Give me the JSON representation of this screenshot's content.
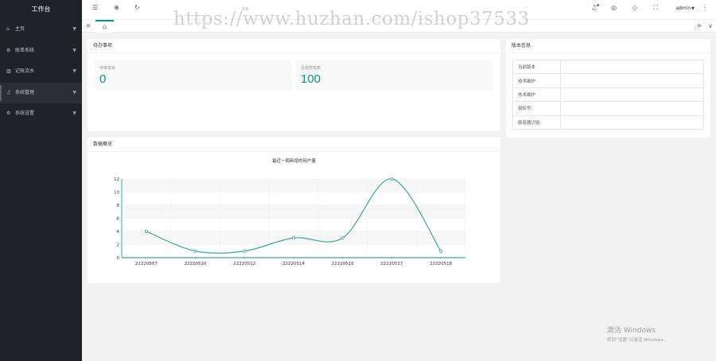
{
  "sidebar": {
    "title": "工作台",
    "items": [
      {
        "icon": "home-icon",
        "glyph": "⌂",
        "label": "主页"
      },
      {
        "icon": "gear-icon",
        "glyph": "⚙",
        "label": "账单系统"
      },
      {
        "icon": "bars-icon",
        "glyph": "▥",
        "label": "记账流水"
      },
      {
        "icon": "bell-icon",
        "glyph": "♫",
        "label": "系统管理"
      },
      {
        "icon": "settings-icon",
        "glyph": "⚙",
        "label": "系统设置"
      }
    ]
  },
  "header": {
    "search_placeholder": "搜索",
    "user": "admin",
    "icons": [
      "menu-toggle-icon",
      "globe-icon",
      "refresh-icon",
      "bell-icon",
      "theme-icon",
      "tag-icon",
      "fullscreen-icon",
      "more-icon"
    ]
  },
  "tabs": {
    "home_icon": "home-icon"
  },
  "todo": {
    "title": "待办事项",
    "stats": [
      {
        "label": "待审笔目",
        "value": "0"
      },
      {
        "label": "总收款笔数",
        "value": "100"
      }
    ]
  },
  "version": {
    "title": "版本信息",
    "rows": [
      {
        "label": "当前版本",
        "value": ""
      },
      {
        "label": "技术维护",
        "value": ""
      },
      {
        "label": "技术维护",
        "value": ""
      },
      {
        "label": "授权号：",
        "value": ""
      },
      {
        "label": "服务器识别：",
        "value": ""
      }
    ]
  },
  "overview": {
    "title": "数据概览"
  },
  "chart_data": {
    "type": "line",
    "title": "最近一周新增的用户量",
    "categories": [
      "22220507",
      "22220510",
      "22220512",
      "22220514",
      "22220516",
      "22220517",
      "22220518"
    ],
    "series": [
      {
        "values": [
          4,
          1,
          1,
          3,
          3,
          12,
          1
        ]
      }
    ],
    "ylim": [
      0,
      12
    ],
    "yticks": [
      0,
      2,
      4,
      6,
      8,
      10,
      12
    ],
    "color": "#3aa89d",
    "grid": true,
    "smooth": true
  },
  "watermark": "https://www.huzhan.com/ishop37533",
  "activation": {
    "line1": "激活 Windows",
    "line2": "转到“设置”以激活 Windows。"
  }
}
